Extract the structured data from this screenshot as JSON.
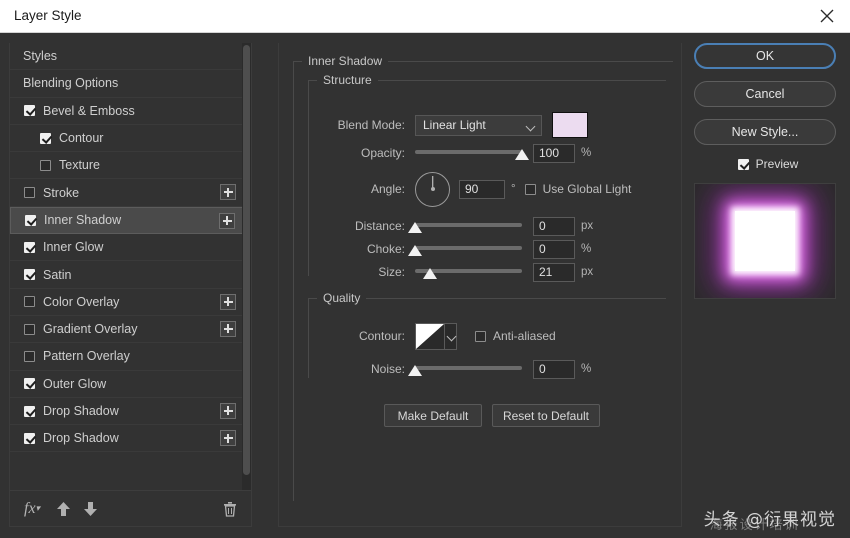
{
  "window": {
    "title": "Layer Style",
    "close_icon": "close-icon"
  },
  "sidebar": {
    "items": [
      {
        "label": "Styles",
        "type": "plain",
        "checked": null,
        "indent": false,
        "selected": false,
        "plus": false
      },
      {
        "label": "Blending Options",
        "type": "plain",
        "checked": null,
        "indent": false,
        "selected": false,
        "plus": false
      },
      {
        "label": "Bevel & Emboss",
        "type": "check",
        "checked": true,
        "indent": false,
        "selected": false,
        "plus": false
      },
      {
        "label": "Contour",
        "type": "check",
        "checked": true,
        "indent": true,
        "selected": false,
        "plus": false
      },
      {
        "label": "Texture",
        "type": "check",
        "checked": false,
        "indent": true,
        "selected": false,
        "plus": false
      },
      {
        "label": "Stroke",
        "type": "check",
        "checked": false,
        "indent": false,
        "selected": false,
        "plus": true
      },
      {
        "label": "Inner Shadow",
        "type": "check",
        "checked": true,
        "indent": false,
        "selected": true,
        "plus": true
      },
      {
        "label": "Inner Glow",
        "type": "check",
        "checked": true,
        "indent": false,
        "selected": false,
        "plus": false
      },
      {
        "label": "Satin",
        "type": "check",
        "checked": true,
        "indent": false,
        "selected": false,
        "plus": false
      },
      {
        "label": "Color Overlay",
        "type": "check",
        "checked": false,
        "indent": false,
        "selected": false,
        "plus": true
      },
      {
        "label": "Gradient Overlay",
        "type": "check",
        "checked": false,
        "indent": false,
        "selected": false,
        "plus": true
      },
      {
        "label": "Pattern Overlay",
        "type": "check",
        "checked": false,
        "indent": false,
        "selected": false,
        "plus": false
      },
      {
        "label": "Outer Glow",
        "type": "check",
        "checked": true,
        "indent": false,
        "selected": false,
        "plus": false
      },
      {
        "label": "Drop Shadow",
        "type": "check",
        "checked": true,
        "indent": false,
        "selected": false,
        "plus": true
      },
      {
        "label": "Drop Shadow",
        "type": "check",
        "checked": true,
        "indent": false,
        "selected": false,
        "plus": true
      }
    ],
    "toolbar": {
      "fx_icon": "fx-icon",
      "move_up_icon": "arrow-up-icon",
      "move_down_icon": "arrow-down-icon",
      "delete_icon": "trash-icon"
    }
  },
  "panel": {
    "group_title": "Inner Shadow",
    "structure": {
      "title": "Structure",
      "blend_mode": {
        "label": "Blend Mode:",
        "value": "Linear Light"
      },
      "color": {
        "swatch_hex": "#ecdcf0"
      },
      "opacity": {
        "label": "Opacity:",
        "value": "100",
        "unit": "%",
        "percent": 100
      },
      "angle": {
        "label": "Angle:",
        "value": "90",
        "unit": "°",
        "degrees": 90
      },
      "use_global_light": {
        "label": "Use Global Light",
        "checked": false
      },
      "distance": {
        "label": "Distance:",
        "value": "0",
        "unit": "px",
        "percent": 0
      },
      "choke": {
        "label": "Choke:",
        "value": "0",
        "unit": "%",
        "percent": 0
      },
      "size": {
        "label": "Size:",
        "value": "21",
        "unit": "px",
        "percent": 14
      }
    },
    "quality": {
      "title": "Quality",
      "contour": {
        "label": "Contour:"
      },
      "anti_aliased": {
        "label": "Anti-aliased",
        "checked": false
      },
      "noise": {
        "label": "Noise:",
        "value": "0",
        "unit": "%",
        "percent": 0
      }
    },
    "buttons": {
      "make_default": "Make Default",
      "reset_to_default": "Reset to Default"
    }
  },
  "right": {
    "ok": "OK",
    "cancel": "Cancel",
    "new_style": "New Style...",
    "preview": {
      "label": "Preview",
      "checked": true
    }
  },
  "watermark": {
    "main": "头条 @衍果视觉",
    "sub": "海报设计培训"
  }
}
